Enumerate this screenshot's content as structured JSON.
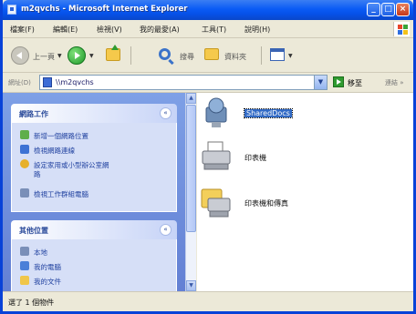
{
  "window": {
    "title": "m2qvchs - Microsoft Internet Explorer"
  },
  "menubar": {
    "items": [
      "檔案(F)",
      "編輯(E)",
      "檢視(V)",
      "我的最愛(A)",
      "工具(T)",
      "說明(H)"
    ]
  },
  "toolbar": {
    "back_label": "上一頁",
    "search_label": "搜尋",
    "folders_label": "資料夾"
  },
  "addressbar": {
    "label": "網址(D)",
    "value": "\\\\m2qvchs",
    "go_label": "移至",
    "links_label": "連結 »"
  },
  "taskpane": {
    "network_tasks": {
      "title": "網路工作",
      "items": [
        {
          "label": "新增一個網路位置",
          "icon": "add-network-place-icon"
        },
        {
          "label": "檢視網路連線",
          "icon": "network-connections-icon"
        },
        {
          "label": "設定家用或小型辦公室網",
          "icon": "help-icon"
        },
        {
          "label": "路",
          "icon": ""
        },
        {
          "label": "檢視工作群組電腦",
          "icon": "workgroup-computers-icon"
        }
      ]
    },
    "other_places": {
      "title": "其他位置",
      "items": [
        {
          "label": "本地",
          "icon": "network-icon"
        },
        {
          "label": "我的電腦",
          "icon": "my-computer-icon"
        },
        {
          "label": "我的文件",
          "icon": "my-documents-icon"
        }
      ]
    }
  },
  "content": {
    "items": [
      {
        "label": "SharedDocs",
        "icon": "shared-folder-icon",
        "selected": true
      },
      {
        "label": "印表機",
        "icon": "printer-icon",
        "selected": false
      },
      {
        "label": "印表機和傳真",
        "icon": "printers-faxes-icon",
        "selected": false
      }
    ]
  },
  "statusbar": {
    "text": "選了 1 個物件"
  },
  "colors": {
    "titlebar": "#0a5bf5",
    "taskpane": "#7ea0e6",
    "selection": "#316ac5"
  }
}
